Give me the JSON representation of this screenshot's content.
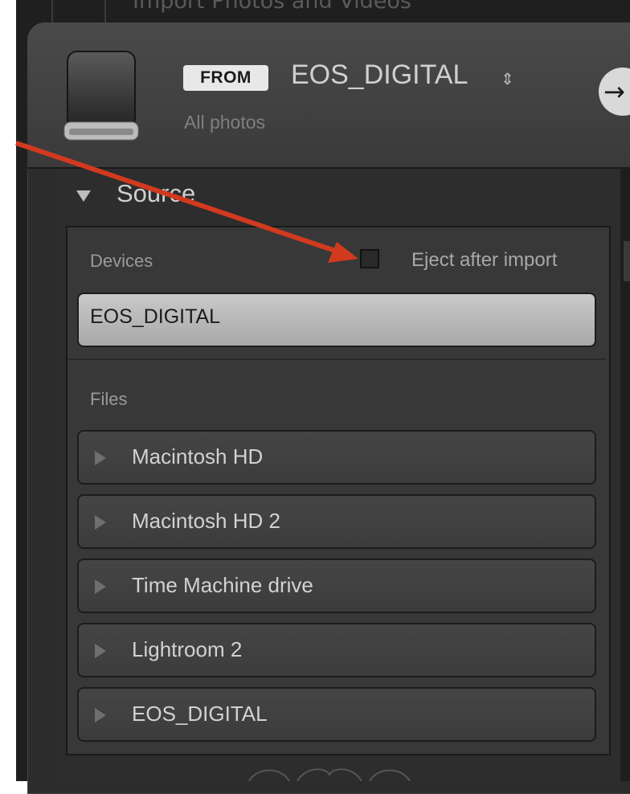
{
  "window": {
    "title": "Import Photos and Videos"
  },
  "header": {
    "from_badge": "FROM",
    "source_name": "EOS_DIGITAL",
    "source_stepper": "⇕",
    "source_subtitle": "All photos",
    "go_arrow": "→",
    "drive_icon": "hard-drive-icon"
  },
  "source_panel": {
    "title": "Source",
    "devices_label": "Devices",
    "eject_label": "Eject after import",
    "eject_checked": false,
    "devices": [
      "EOS_DIGITAL"
    ],
    "files_label": "Files",
    "files": [
      "Macintosh HD",
      "Macintosh HD 2",
      "Time Machine drive",
      "Lightroom 2",
      "EOS_DIGITAL"
    ]
  },
  "colors": {
    "panel_background": "#2c2c2c",
    "selected_device": "#bdbdbd",
    "annotation_arrow": "#d13a1f"
  }
}
